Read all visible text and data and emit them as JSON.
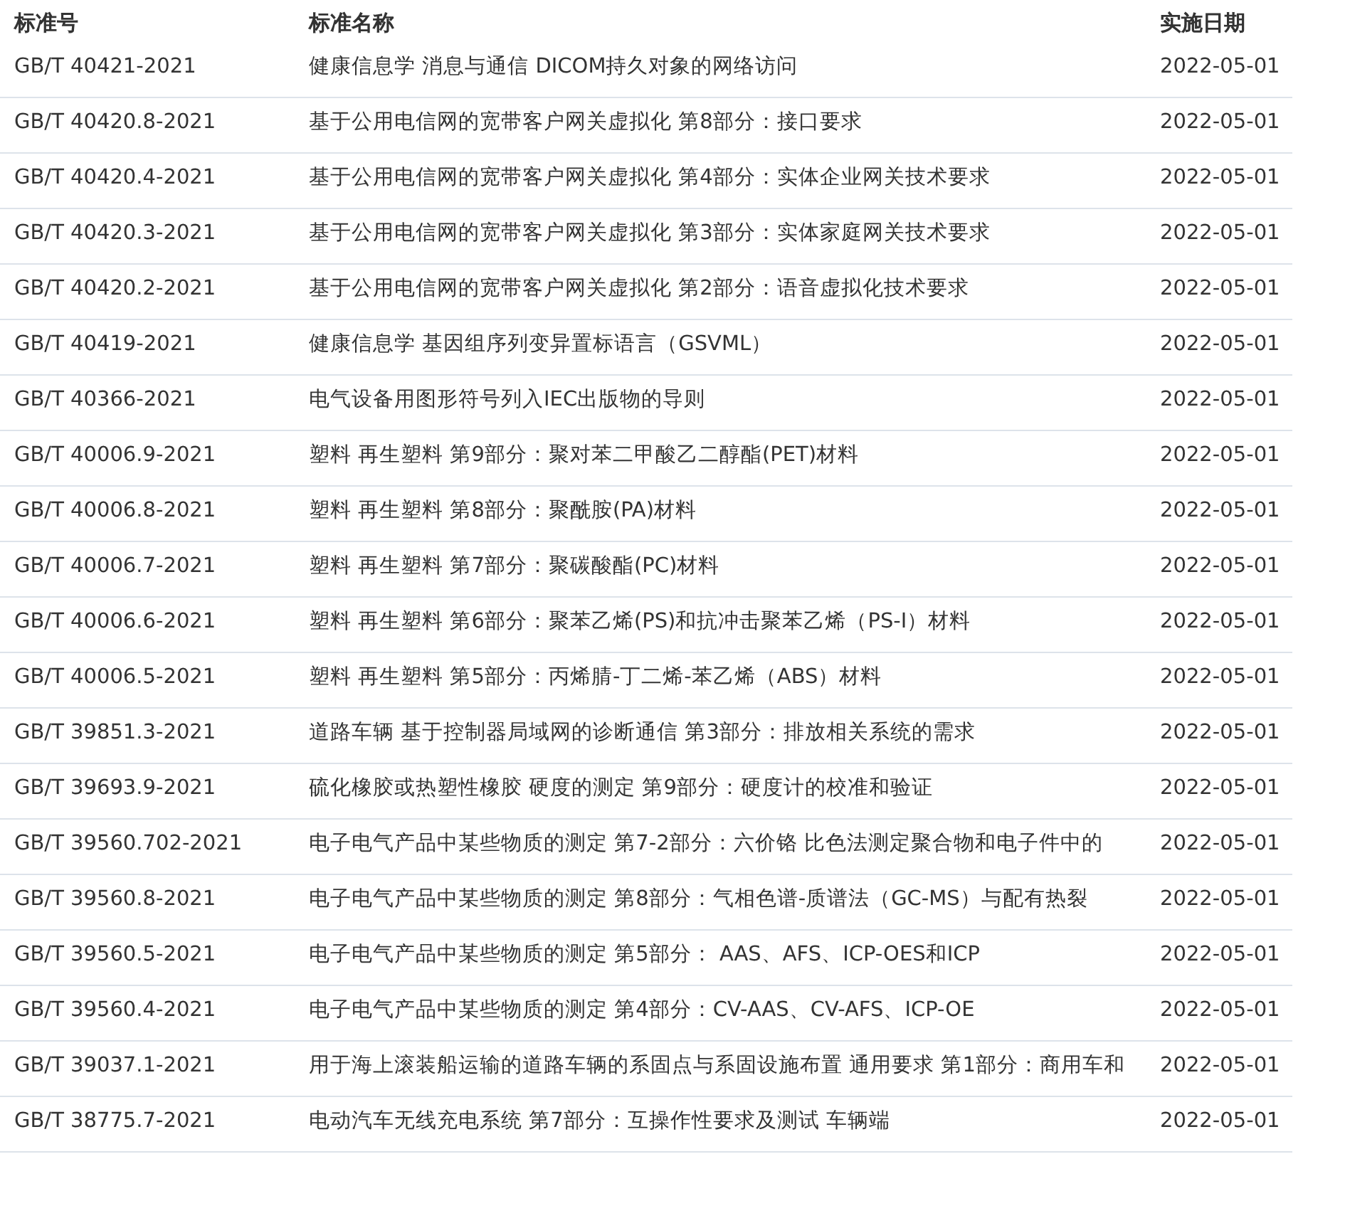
{
  "table": {
    "columns": [
      "标准号",
      "标准名称",
      "实施日期"
    ],
    "rows": [
      {
        "code": "GB/T 40421-2021",
        "name": "健康信息学 消息与通信 DICOM持久对象的网络访问",
        "date": "2022-05-01"
      },
      {
        "code": "GB/T 40420.8-2021",
        "name": "基于公用电信网的宽带客户网关虚拟化 第8部分：接口要求",
        "date": "2022-05-01"
      },
      {
        "code": "GB/T 40420.4-2021",
        "name": "基于公用电信网的宽带客户网关虚拟化 第4部分：实体企业网关技术要求",
        "date": "2022-05-01"
      },
      {
        "code": "GB/T 40420.3-2021",
        "name": "基于公用电信网的宽带客户网关虚拟化 第3部分：实体家庭网关技术要求",
        "date": "2022-05-01"
      },
      {
        "code": "GB/T 40420.2-2021",
        "name": "基于公用电信网的宽带客户网关虚拟化 第2部分：语音虚拟化技术要求",
        "date": "2022-05-01"
      },
      {
        "code": "GB/T 40419-2021",
        "name": "健康信息学 基因组序列变异置标语言（GSVML）",
        "date": "2022-05-01"
      },
      {
        "code": "GB/T 40366-2021",
        "name": "电气设备用图形符号列入IEC出版物的导则",
        "date": "2022-05-01"
      },
      {
        "code": "GB/T 40006.9-2021",
        "name": "塑料 再生塑料 第9部分：聚对苯二甲酸乙二醇酯(PET)材料",
        "date": "2022-05-01"
      },
      {
        "code": "GB/T 40006.8-2021",
        "name": "塑料 再生塑料 第8部分：聚酰胺(PA)材料",
        "date": "2022-05-01"
      },
      {
        "code": "GB/T 40006.7-2021",
        "name": "塑料 再生塑料 第7部分：聚碳酸酯(PC)材料",
        "date": "2022-05-01"
      },
      {
        "code": "GB/T 40006.6-2021",
        "name": "塑料 再生塑料 第6部分：聚苯乙烯(PS)和抗冲击聚苯乙烯（PS-I）材料",
        "date": "2022-05-01"
      },
      {
        "code": "GB/T 40006.5-2021",
        "name": "塑料 再生塑料 第5部分：丙烯腈-丁二烯-苯乙烯（ABS）材料",
        "date": "2022-05-01"
      },
      {
        "code": "GB/T 39851.3-2021",
        "name": "道路车辆 基于控制器局域网的诊断通信 第3部分：排放相关系统的需求",
        "date": "2022-05-01"
      },
      {
        "code": "GB/T 39693.9-2021",
        "name": "硫化橡胶或热塑性橡胶 硬度的测定 第9部分：硬度计的校准和验证",
        "date": "2022-05-01"
      },
      {
        "code": "GB/T 39560.702-2021",
        "name": "电子电气产品中某些物质的测定 第7-2部分：六价铬 比色法测定聚合物和电子件中的",
        "date": "2022-05-01"
      },
      {
        "code": "GB/T 39560.8-2021",
        "name": "电子电气产品中某些物质的测定 第8部分：气相色谱-质谱法（GC-MS）与配有热裂",
        "date": "2022-05-01"
      },
      {
        "code": "GB/T 39560.5-2021",
        "name": "电子电气产品中某些物质的测定 第5部分： AAS、AFS、ICP-OES和ICP",
        "date": "2022-05-01"
      },
      {
        "code": "GB/T 39560.4-2021",
        "name": "电子电气产品中某些物质的测定 第4部分：CV-AAS、CV-AFS、ICP-OE",
        "date": "2022-05-01"
      },
      {
        "code": "GB/T 39037.1-2021",
        "name": "用于海上滚装船运输的道路车辆的系固点与系固设施布置 通用要求 第1部分：商用车和",
        "date": "2022-05-01"
      },
      {
        "code": "GB/T 38775.7-2021",
        "name": "电动汽车无线充电系统 第7部分：互操作性要求及测试 车辆端",
        "date": "2022-05-01"
      }
    ]
  }
}
